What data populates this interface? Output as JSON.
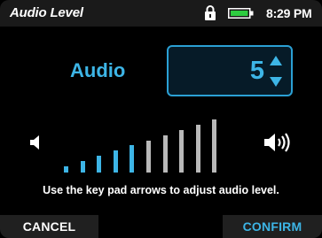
{
  "status_bar": {
    "title": "Audio Level",
    "time": "8:29 PM",
    "lock_icon": "lock-icon",
    "battery_icon": "battery-icon"
  },
  "audio": {
    "label": "Audio",
    "value": "5",
    "increase_icon": "chevron-up-icon",
    "decrease_icon": "chevron-down-icon"
  },
  "meter": {
    "level": 5,
    "max": 10,
    "low_icon": "volume-low-icon",
    "high_icon": "volume-high-icon",
    "active_color": "#3db5e6",
    "inactive_color": "#b9b9b9"
  },
  "instruction": "Use the key pad arrows to adjust audio level.",
  "buttons": {
    "cancel": "CANCEL",
    "confirm": "CONFIRM"
  },
  "colors": {
    "accent": "#3db5e6",
    "background": "#000000",
    "bar_background": "#202020"
  }
}
